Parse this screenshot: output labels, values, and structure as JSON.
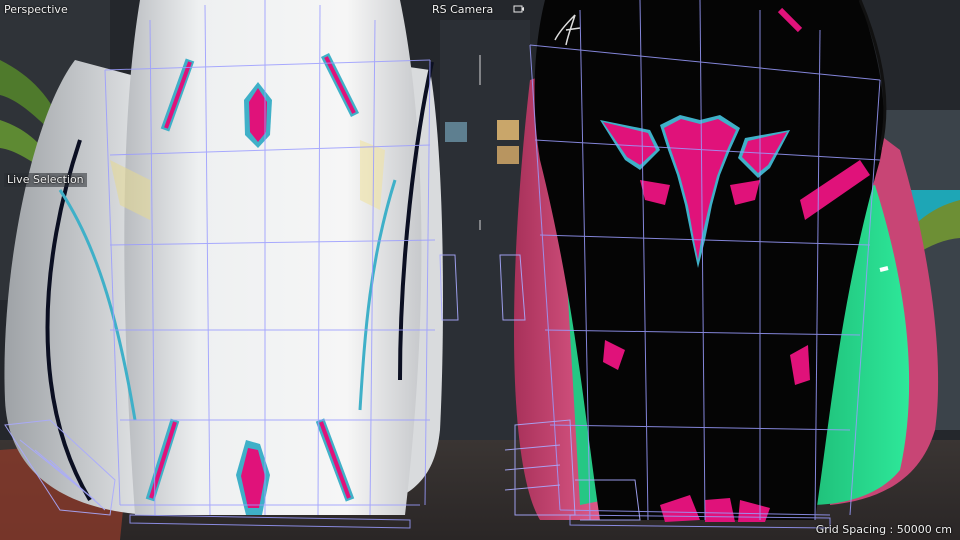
{
  "viewport": {
    "view_name": "Perspective",
    "camera_name": "RS Camera",
    "tool_name": "Live Selection",
    "grid_spacing": "Grid Spacing : 50000 cm"
  },
  "icons": {
    "camera_icon": "camera-lock-icon"
  },
  "colors": {
    "wireframe": "#9a9cff",
    "chair_white": "#eeeeee",
    "chair_black": "#050505",
    "accent_magenta": "#e0127a",
    "accent_cyan": "#3fb0c8",
    "panel_pink": "#d9507e",
    "panel_green": "#27d98c",
    "background": "#1e2125"
  }
}
